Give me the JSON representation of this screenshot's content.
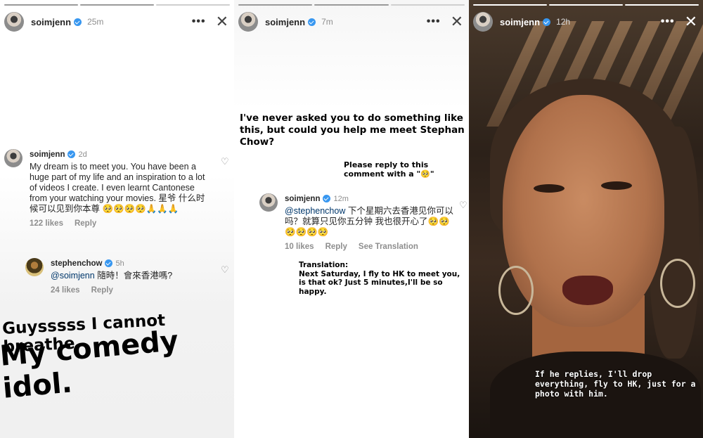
{
  "panel1": {
    "username": "soimjenn",
    "time": "25m",
    "comment1": {
      "name": "soimjenn",
      "time": "2d",
      "text": "My dream is to meet you. You have been a huge part of my life and an inspiration to a lot of videos I create. I even learnt Cantonese from your watching your movies. 星爷 什么时候可以见到你本尊 🥺🥺🥺🥺🙏🙏🙏",
      "likes": "122 likes",
      "reply": "Reply"
    },
    "comment2": {
      "name": "stephenchow",
      "time": "5h",
      "mention": "@soimjenn",
      "text": " 隨時！會來香港嗎?",
      "likes": "24 likes",
      "reply": "Reply"
    },
    "sticker_line1": "Guysssss I cannot breathe",
    "sticker_line2": "My comedy idol."
  },
  "panel2": {
    "username": "soimjenn",
    "time": "7m",
    "question": "I've never asked you to do something like this, but could you help me meet Stephan Chow?",
    "request": "Please reply to this comment with a \"🥺\"",
    "comment": {
      "name": "soimjenn",
      "time": "12m",
      "mention": "@stephenchow",
      "text": " 下个星期六去香港见你可以吗？就算只见你五分钟 我也很开心了🥺🥺🥺🥺🥺🥺",
      "likes": "10 likes",
      "reply": "Reply",
      "see_translation": "See Translation"
    },
    "translation_label": "Translation:",
    "translation_text": "Next Saturday, I fly to HK to meet you, is that ok? Just 5 minutes,I'll be so happy."
  },
  "panel3": {
    "username": "soimjenn",
    "time": "12h",
    "caption": "If he replies, I'll drop everything, fly to HK, just for a photo with him."
  },
  "icons": {
    "more": "•••",
    "close": "✕",
    "heart": "♡"
  }
}
